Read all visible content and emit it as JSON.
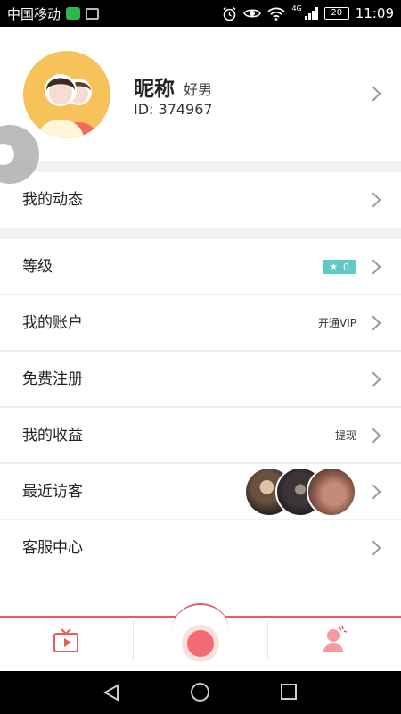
{
  "status_bar": {
    "carrier": "中国移动",
    "network": "4G",
    "battery": "20",
    "time": "11:09"
  },
  "profile": {
    "nickname": "昵称",
    "gender": "好男",
    "id_label": "ID: 374967"
  },
  "menu": {
    "moments": "我的动态",
    "level": "等级",
    "level_value": "0",
    "account": "我的账户",
    "account_action": "开通VIP",
    "register": "免费注册",
    "earnings": "我的收益",
    "earnings_action": "提现",
    "visitors": "最近访客",
    "service": "客服中心"
  },
  "colors": {
    "accent": "#e85c5c",
    "level_badge": "#5ec9c5",
    "avatar_bg": "#f7c25a"
  },
  "icons": {
    "tab_left": "tv-icon",
    "tab_center": "record-button",
    "tab_right": "person-icon"
  }
}
